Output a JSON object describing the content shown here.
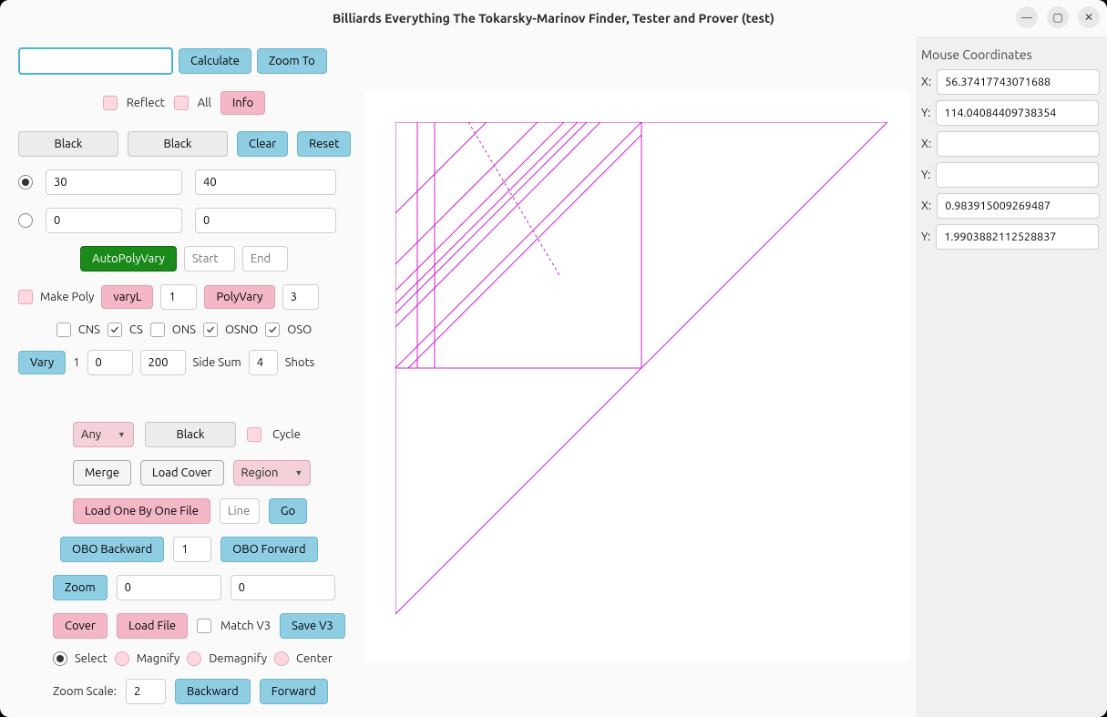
{
  "window": {
    "title": "Billiards Everything The Tokarsky-Marinov Finder, Tester and Prover (test)"
  },
  "top": {
    "calculate": "Calculate",
    "zoom_to": "Zoom To",
    "reflect": "Reflect",
    "all": "All",
    "info": "Info"
  },
  "black_row": {
    "black1": "Black",
    "black2": "Black",
    "clear": "Clear",
    "reset": "Reset"
  },
  "angles": {
    "a1": "30",
    "a2": "40",
    "b1": "0",
    "b2": "0"
  },
  "poly": {
    "auto_poly_vary": "AutoPolyVary",
    "start_ph": "Start",
    "end_ph": "End",
    "make_poly": "Make Poly",
    "vary_l": "varyL",
    "vary_l_val": "1",
    "poly_vary": "PolyVary",
    "poly_vary_val": "3"
  },
  "checks": {
    "cns": "CNS",
    "cs": "CS",
    "ons": "ONS",
    "osno": "OSNO",
    "oso": "OSO"
  },
  "vary": {
    "vary": "Vary",
    "one": "1",
    "v1": "0",
    "v2": "200",
    "side_sum": "Side Sum",
    "side_sum_val": "4",
    "shots": "Shots"
  },
  "cover": {
    "any": "Any",
    "black": "Black",
    "cycle": "Cycle",
    "merge": "Merge",
    "load_cover": "Load Cover",
    "region": "Region",
    "load_obo": "Load One By One File",
    "line_ph": "Line",
    "go": "Go",
    "obo_back": "OBO Backward",
    "obo_val": "1",
    "obo_fwd": "OBO Forward",
    "zoom": "Zoom",
    "zx": "0",
    "zy": "0",
    "cover_btn": "Cover",
    "load_file": "Load File",
    "match_v3": "Match V3",
    "save_v3": "Save V3"
  },
  "view_mode": {
    "select": "Select",
    "magnify": "Magnify",
    "demagnify": "Demagnify",
    "center": "Center"
  },
  "nav": {
    "zoom_scale": "Zoom Scale:",
    "zoom_scale_val": "2",
    "backward": "Backward",
    "forward": "Forward"
  },
  "coords": {
    "heading": "Mouse Coordinates",
    "x1": "56.37417743071688",
    "y1": "114.04084409738354",
    "x2": "",
    "y2": "",
    "x3": "0.983915009269487",
    "y3": "1.9903882112528837"
  }
}
